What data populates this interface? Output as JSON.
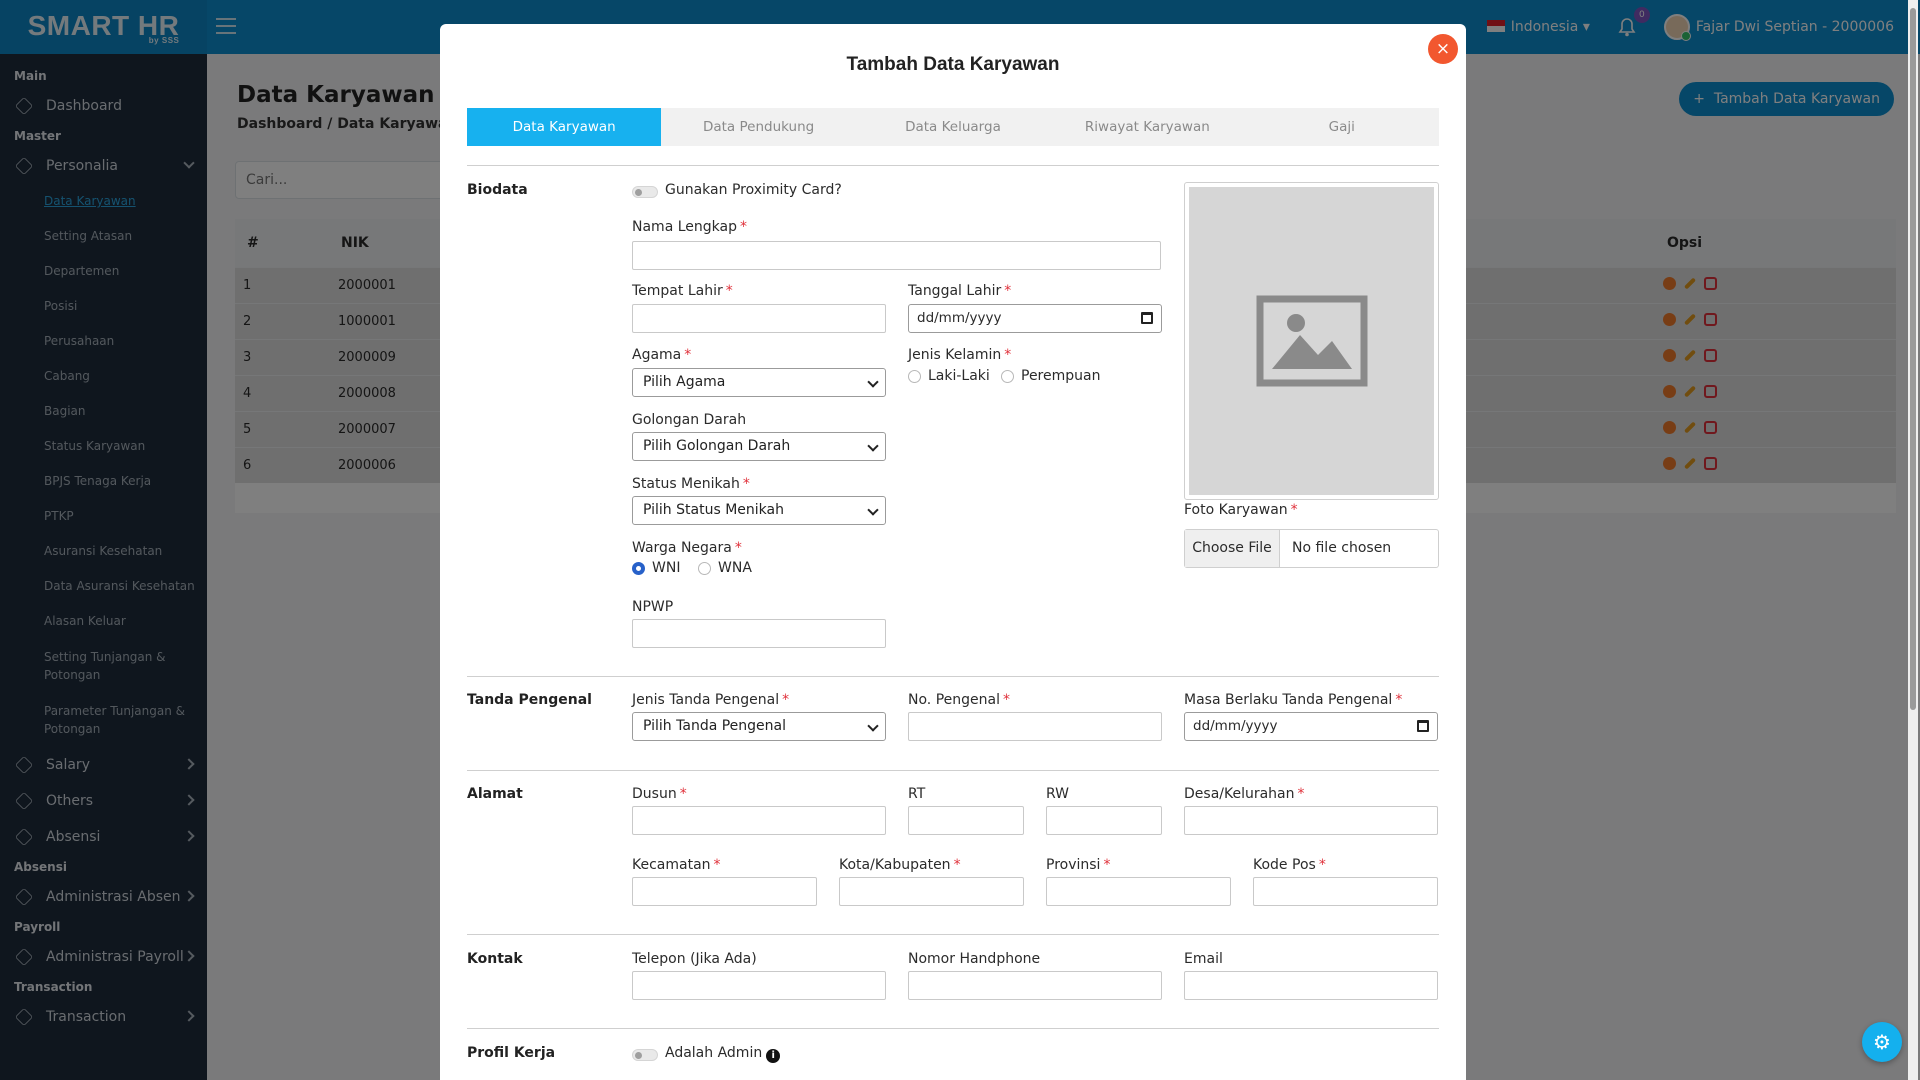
{
  "app": {
    "logo": "SMART HR",
    "logo_sub": "by SSS",
    "language": "Indonesia",
    "notifications": "0",
    "user": "Fajar Dwi Septian - 2000006"
  },
  "sidebar": {
    "main_label": "Main",
    "dashboard": "Dashboard",
    "master_label": "Master",
    "personalia": "Personalia",
    "sub": [
      "Data Karyawan",
      "Setting Atasan",
      "Departemen",
      "Posisi",
      "Perusahaan",
      "Cabang",
      "Bagian",
      "Status Karyawan",
      "BPJS Tenaga Kerja",
      "PTKP",
      "Asuransi Kesehatan",
      "Data Asuransi Kesehatan",
      "Alasan Keluar"
    ],
    "sub_two": [
      "Setting Tunjangan & Potongan",
      "Parameter Tunjangan & Potongan"
    ],
    "salary": "Salary",
    "others": "Others",
    "absensi": "Absensi",
    "absensi_label": "Absensi",
    "adm_absen": "Administrasi Absen",
    "payroll_label": "Payroll",
    "adm_payroll": "Administrasi Payroll",
    "transaction_label": "Transaction",
    "transaction": "Transaction"
  },
  "page": {
    "title": "Data Karyawan",
    "breadcrumb": "Dashboard / Data Karyawan",
    "add_button": "Tambah Data Karyawan",
    "search_placeholder": "Cari...",
    "table_headers": {
      "no": "#",
      "nik": "NIK",
      "opsi": "Opsi"
    },
    "rows": [
      {
        "no": "1",
        "nik": "2000001"
      },
      {
        "no": "2",
        "nik": "1000001"
      },
      {
        "no": "3",
        "nik": "2000009"
      },
      {
        "no": "4",
        "nik": "2000008"
      },
      {
        "no": "5",
        "nik": "2000007"
      },
      {
        "no": "6",
        "nik": "2000006"
      }
    ]
  },
  "modal": {
    "title": "Tambah Data Karyawan",
    "close": "×",
    "tabs": [
      "Data Karyawan",
      "Data Pendukung",
      "Data Keluarga",
      "Riwayat Karyawan",
      "Gaji"
    ],
    "biodata": {
      "section": "Biodata",
      "proximity": "Gunakan Proximity Card?",
      "nama_lengkap": "Nama Lengkap",
      "tempat_lahir": "Tempat Lahir",
      "tanggal_lahir": "Tanggal Lahir",
      "date_placeholder": "dd/mm/yyyy",
      "agama": "Agama",
      "agama_value": "Pilih Agama",
      "jenis_kelamin": "Jenis Kelamin",
      "laki": "Laki-Laki",
      "perempuan": "Perempuan",
      "golongan_darah": "Golongan Darah",
      "golongan_value": "Pilih Golongan Darah",
      "status_menikah": "Status Menikah",
      "status_value": "Pilih Status Menikah",
      "warga_negara": "Warga Negara",
      "wni": "WNI",
      "wna": "WNA",
      "npwp": "NPWP",
      "foto": "Foto Karyawan",
      "choose_file": "Choose File",
      "no_file": "No file chosen"
    },
    "tanda_pengenal": {
      "section": "Tanda Pengenal",
      "jenis": "Jenis Tanda Pengenal",
      "jenis_value": "Pilih Tanda Pengenal",
      "no": "No. Pengenal",
      "masa": "Masa Berlaku Tanda Pengenal",
      "date_placeholder": "dd/mm/yyyy"
    },
    "alamat": {
      "section": "Alamat",
      "dusun": "Dusun",
      "rt": "RT",
      "rw": "RW",
      "desa": "Desa/Kelurahan",
      "kecamatan": "Kecamatan",
      "kota": "Kota/Kabupaten",
      "provinsi": "Provinsi",
      "kode_pos": "Kode Pos"
    },
    "kontak": {
      "section": "Kontak",
      "telepon": "Telepon (Jika Ada)",
      "hp": "Nomor Handphone",
      "email": "Email"
    },
    "profil": {
      "section": "Profil Kerja",
      "admin": "Adalah Admin"
    }
  },
  "colors": {
    "primary": "#0d8fd1",
    "tab_active": "#17b1ef",
    "close": "#f2572f",
    "required": "#e0303a"
  }
}
